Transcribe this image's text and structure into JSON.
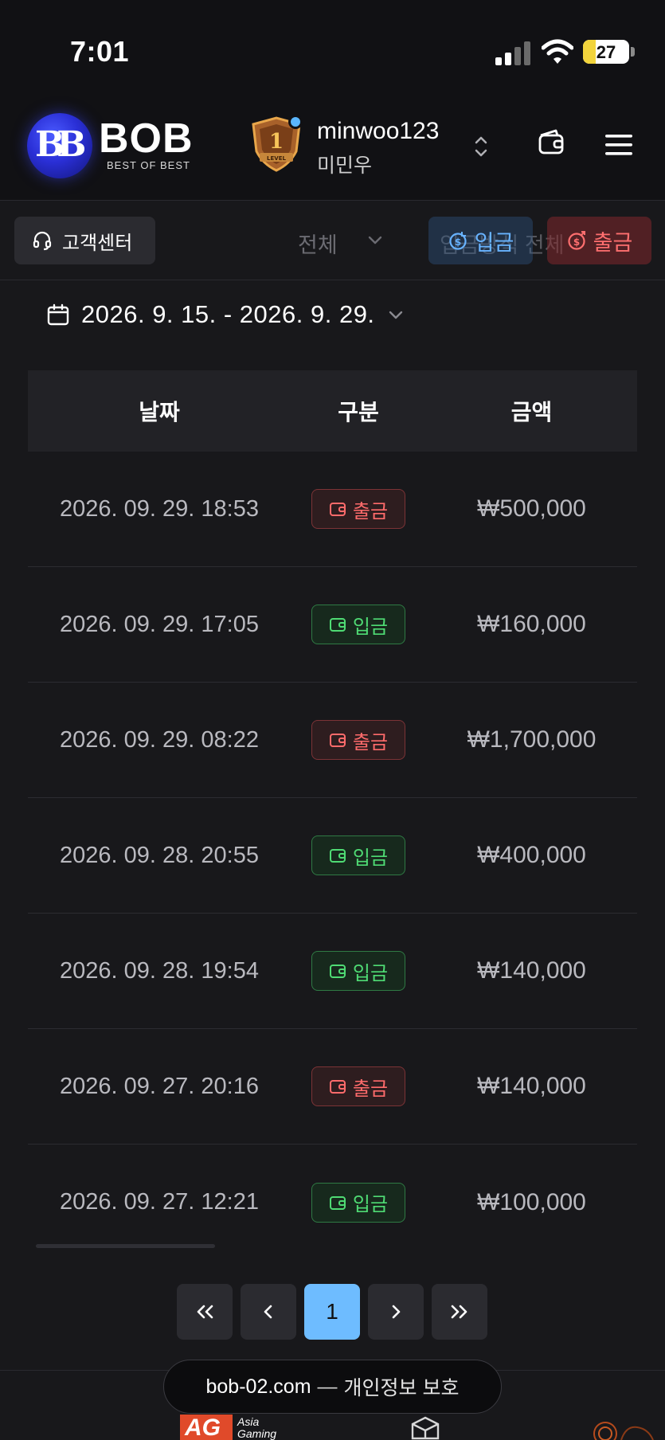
{
  "status_bar": {
    "time": "7:01",
    "battery": "27"
  },
  "header": {
    "logo_word": "BOB",
    "logo_sub": "BEST OF BEST",
    "logo_mark": "BB",
    "level_badge_text": "LEVEL",
    "level_number": "1",
    "username": "minwoo123",
    "nickname": "미민우"
  },
  "toolbar": {
    "support_label": "고객센터",
    "filter_selected": "전체",
    "method_filter": "입금방식 전체",
    "deposit_label": "입금",
    "withdraw_label": "출금"
  },
  "date_range": "2026. 9. 15. - 2026. 9. 29.",
  "table": {
    "headers": {
      "date": "날짜",
      "type": "구분",
      "amount": "금액"
    },
    "rows": [
      {
        "date": "2026. 09. 29. 18:53",
        "type": "출금",
        "kind": "out",
        "amount": "₩500,000"
      },
      {
        "date": "2026. 09. 29. 17:05",
        "type": "입금",
        "kind": "in",
        "amount": "₩160,000"
      },
      {
        "date": "2026. 09. 29. 08:22",
        "type": "출금",
        "kind": "out",
        "amount": "₩1,700,000"
      },
      {
        "date": "2026. 09. 28. 20:55",
        "type": "입금",
        "kind": "in",
        "amount": "₩400,000"
      },
      {
        "date": "2026. 09. 28. 19:54",
        "type": "입금",
        "kind": "in",
        "amount": "₩140,000"
      },
      {
        "date": "2026. 09. 27. 20:16",
        "type": "출금",
        "kind": "out",
        "amount": "₩140,000"
      },
      {
        "date": "2026. 09. 27. 12:21",
        "type": "입금",
        "kind": "in",
        "amount": "₩100,000"
      }
    ]
  },
  "pagination": {
    "current": "1"
  },
  "footer": {
    "url": "bob-02.com",
    "separator": "—",
    "description": "개인정보 보호",
    "provider_ag": "AG",
    "provider_ag_sub": "Asia Gaming"
  },
  "colors": {
    "background": "#18181b",
    "deposit": "#4fdb74",
    "withdraw": "#ff6b6b",
    "accent": "#6ebcff"
  }
}
